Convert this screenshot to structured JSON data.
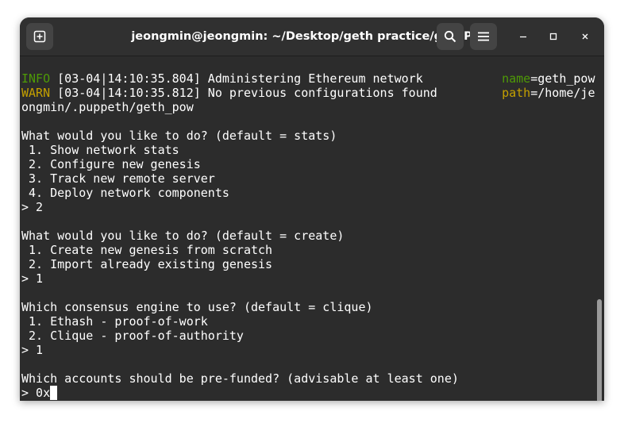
{
  "window": {
    "title": "jeongmin@jeongmin: ~/Desktop/geth practice/gethPoW"
  },
  "icons": {
    "new_tab": "new-tab-icon",
    "search": "search-icon",
    "menu": "hamburger-menu-icon",
    "minimize": "minimize-icon",
    "maximize": "maximize-icon",
    "close": "close-icon"
  },
  "colors": {
    "terminal_bg": "#2c2c2c",
    "info_green": "#4e9a06",
    "warn_yellow": "#c4a000",
    "text": "#ffffff"
  },
  "log": [
    {
      "level": "INFO",
      "msg": " [03-04|14:10:35.804] Administering Ethereum network           ",
      "key": "name",
      "value": "=geth_pow"
    },
    {
      "level": "WARN",
      "msg": " [03-04|14:10:35.812] No previous configurations found         ",
      "key": "path",
      "value": "=/home/je"
    }
  ],
  "lines": [
    "ongmin/.puppeth/geth_pow",
    "",
    "What would you like to do? (default = stats)",
    " 1. Show network stats",
    " 2. Configure new genesis",
    " 3. Track new remote server",
    " 4. Deploy network components",
    "> 2",
    "",
    "What would you like to do? (default = create)",
    " 1. Create new genesis from scratch",
    " 2. Import already existing genesis",
    "> 1",
    "",
    "Which consensus engine to use? (default = clique)",
    " 1. Ethash - proof-of-work",
    " 2. Clique - proof-of-authority",
    "> 1",
    "",
    "Which accounts should be pre-funded? (advisable at least one)"
  ],
  "prompt": {
    "text": "> 0x"
  }
}
